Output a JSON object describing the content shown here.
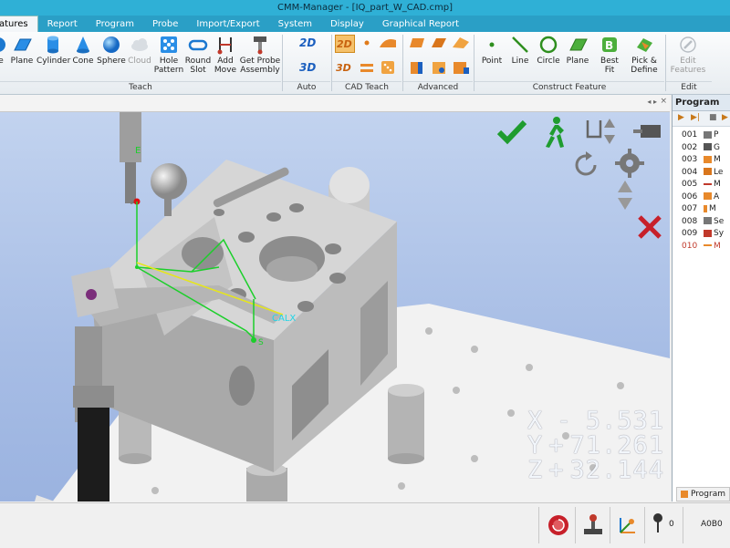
{
  "window": {
    "title": "CMM-Manager - [IQ_part_W_CAD.cmp]"
  },
  "tabs": [
    {
      "label": "atures",
      "active": true
    },
    {
      "label": "Report"
    },
    {
      "label": "Program"
    },
    {
      "label": "Probe"
    },
    {
      "label": "Import/Export"
    },
    {
      "label": "System"
    },
    {
      "label": "Display"
    },
    {
      "label": "Graphical Report"
    }
  ],
  "ribbon": {
    "teach": [
      "e",
      "Plane",
      "Cylinder",
      "Cone",
      "Sphere",
      "Cloud",
      "Hole",
      "Pattern",
      "Round",
      "Slot",
      "Add",
      "Move",
      "Get Probe",
      "Assembly"
    ],
    "groups": {
      "teach": "Teach",
      "auto": "Auto Feature",
      "cad": "CAD Teach",
      "advanced": "Advanced",
      "construct": "Construct Feature",
      "edit": "Edit Feature"
    },
    "construct": [
      "Point",
      "Line",
      "Circle",
      "Plane",
      "Best",
      "Fit",
      "Pick &",
      "Define"
    ],
    "edit": [
      "Edit",
      "Features"
    ]
  },
  "program": {
    "header": "Program",
    "rows": [
      "001",
      "002",
      "003",
      "004",
      "005",
      "006",
      "007",
      "008",
      "009",
      "010"
    ],
    "row_labels": [
      "P",
      "G",
      "M",
      "Le",
      "M",
      "A",
      "M",
      "Se",
      "Sy",
      "M"
    ],
    "footer_tab": "Program"
  },
  "viewport": {
    "probe_label": "E",
    "axis_label": "CALX",
    "point_label": "S",
    "coords": {
      "x_label": "X",
      "x_sign": "-",
      "x_value": "5.531",
      "y_label": "Y",
      "y_sign": "+",
      "y_value": "71.261",
      "z_label": "Z",
      "z_sign": "+",
      "z_value": "32.144"
    }
  },
  "status": {
    "probe_count": "0",
    "code": "A0B0"
  }
}
